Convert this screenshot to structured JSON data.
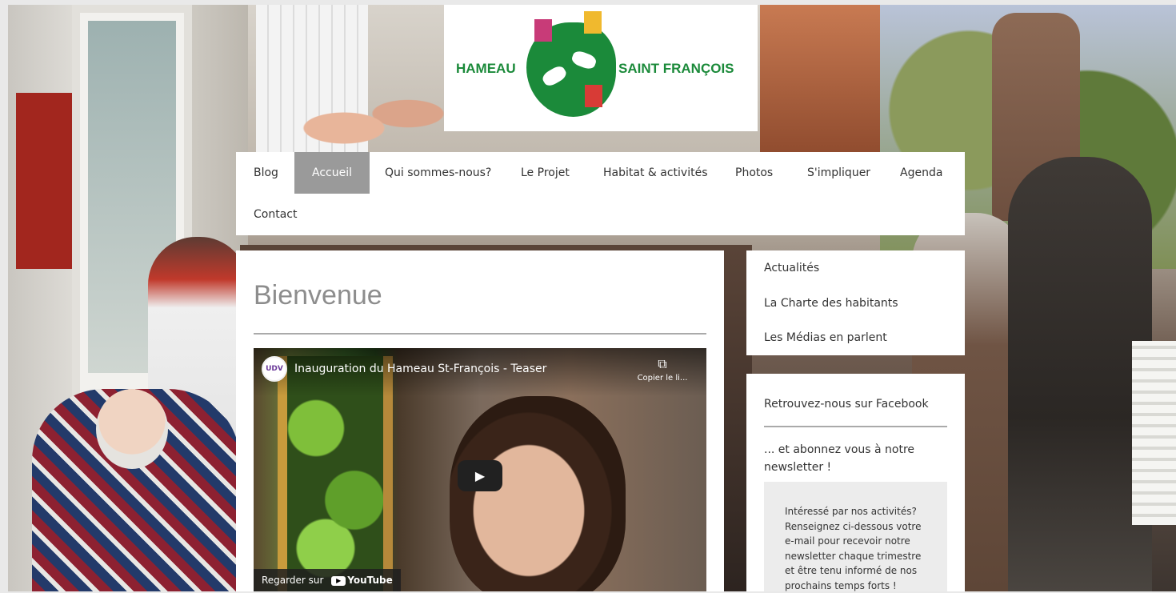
{
  "logo": {
    "word_left": "HAMEAU",
    "word_right": "SAINT FRANÇOIS",
    "colors": {
      "green": "#1b8a3a",
      "pink": "#c83b78",
      "yellow": "#f0b92e",
      "red": "#d83b36"
    }
  },
  "nav": {
    "items": [
      {
        "label": "Blog"
      },
      {
        "label": "Accueil",
        "active": true
      },
      {
        "label": "Qui sommes-nous?"
      },
      {
        "label": "Le Projet"
      },
      {
        "label": "Habitat & activités"
      },
      {
        "label": "Photos"
      },
      {
        "label": "S'impliquer"
      },
      {
        "label": "Agenda"
      },
      {
        "label": "Contact"
      }
    ],
    "active_color": "#9a9a9a"
  },
  "main": {
    "title": "Bienvenue",
    "video": {
      "channel_badge": "UDV",
      "title": "Inauguration du Hameau St-François - Teaser",
      "copy_label": "Copier le li...",
      "watch_label": "Regarder sur",
      "youtube_label": "YouTube",
      "play_icon": "play-icon",
      "copy_icon": "copy-icon"
    }
  },
  "sidebar": {
    "menu": [
      {
        "label": "Actualités"
      },
      {
        "label": "La Charte des habitants"
      },
      {
        "label": "Les Médias en parlent"
      }
    ],
    "facebook": "Retrouvez-nous sur Facebook",
    "newsletter_title": "... et abonnez vous à notre newsletter !",
    "newsletter_text": "Intéressé par nos activités? Renseignez ci-dessous votre e-mail pour recevoir notre newsletter chaque trimestre et être tenu informé de nos prochains temps forts !"
  }
}
